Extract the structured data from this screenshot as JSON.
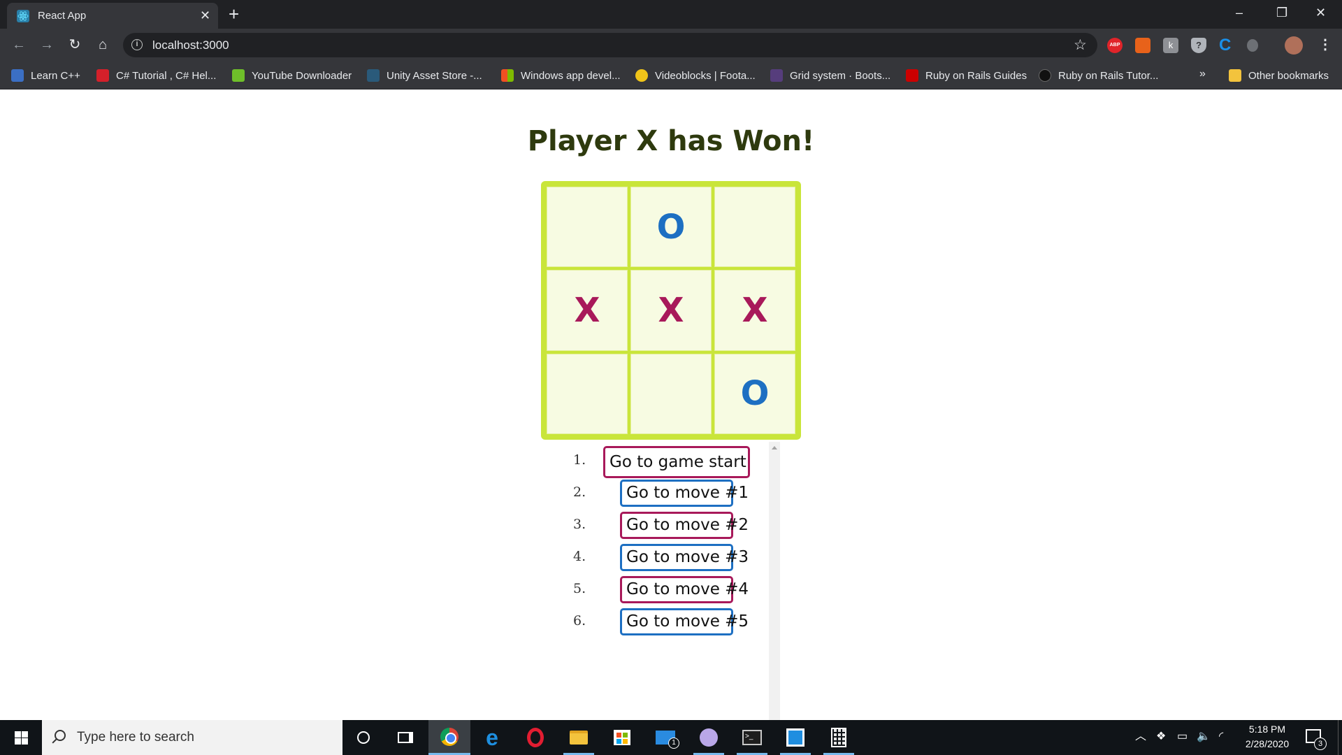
{
  "browser": {
    "tab_title": "React App",
    "tab_close": "✕",
    "new_tab": "+",
    "window_controls": {
      "minimize": "–",
      "maximize": "❐",
      "close": "✕"
    },
    "nav": {
      "back": "←",
      "forward": "→",
      "reload": "↻",
      "home": "⌂"
    },
    "url": "localhost:3000",
    "info_glyph": "i",
    "star_glyph": "☆",
    "extensions": {
      "abp": "ABP",
      "k": "k",
      "shield": "?",
      "c": "C"
    },
    "menu_glyph": "⋮",
    "bookmarks": [
      {
        "label": "Learn C++",
        "icon": "cpp-icon",
        "color": "#3b6fc4"
      },
      {
        "label": "C# Tutorial , C# Hel...",
        "icon": "n-logo-icon",
        "color": "#d4202a"
      },
      {
        "label": "YouTube Downloader",
        "icon": "download-arrow-icon",
        "color": "#6fbf2a"
      },
      {
        "label": "Unity Asset Store -...",
        "icon": "unity-icon",
        "color": "#2a5a7a"
      },
      {
        "label": "Windows app devel...",
        "icon": "windows-logo-icon",
        "color": "#f25022"
      },
      {
        "label": "Videoblocks | Foota...",
        "icon": "videoblocks-icon",
        "color": "#f0c419"
      },
      {
        "label": "Grid system · Boots...",
        "icon": "bootstrap-icon",
        "color": "#563d7c"
      },
      {
        "label": "Ruby on Rails Guides",
        "icon": "rails-icon",
        "color": "#cc0000"
      },
      {
        "label": "Ruby on Rails Tutor...",
        "icon": "rails-tutorial-icon",
        "color": "#111111"
      }
    ],
    "bookmarks_overflow": "»",
    "other_bookmarks": {
      "label": "Other bookmarks",
      "icon": "folder-icon",
      "color": "#f3c33d"
    }
  },
  "game": {
    "status": "Player X has Won!",
    "squares": [
      "",
      "O",
      "",
      "X",
      "X",
      "X",
      "",
      "",
      "O"
    ],
    "colors": {
      "X": "#a8195a",
      "O": "#1d6fc2",
      "board": "#c9e53a",
      "cell": "#f7fbe2"
    },
    "moves": [
      {
        "num": "1.",
        "label": "Go to game start",
        "color": "pink"
      },
      {
        "num": "2.",
        "label": "Go to move #1",
        "color": "blue"
      },
      {
        "num": "3.",
        "label": "Go to move #2",
        "color": "pink"
      },
      {
        "num": "4.",
        "label": "Go to move #3",
        "color": "blue"
      },
      {
        "num": "5.",
        "label": "Go to move #4",
        "color": "pink"
      },
      {
        "num": "6.",
        "label": "Go to move #5",
        "color": "blue"
      }
    ]
  },
  "taskbar": {
    "search_placeholder": "Type here to search",
    "mail_badge": "1",
    "terminal_glyph": ">_",
    "tray": {
      "chevron": "︿",
      "dropbox": "❖",
      "battery": "▭",
      "volume": "🔈",
      "wifi": "◜"
    },
    "clock_time": "5:18 PM",
    "clock_date": "2/28/2020",
    "notification_badge": "3"
  }
}
